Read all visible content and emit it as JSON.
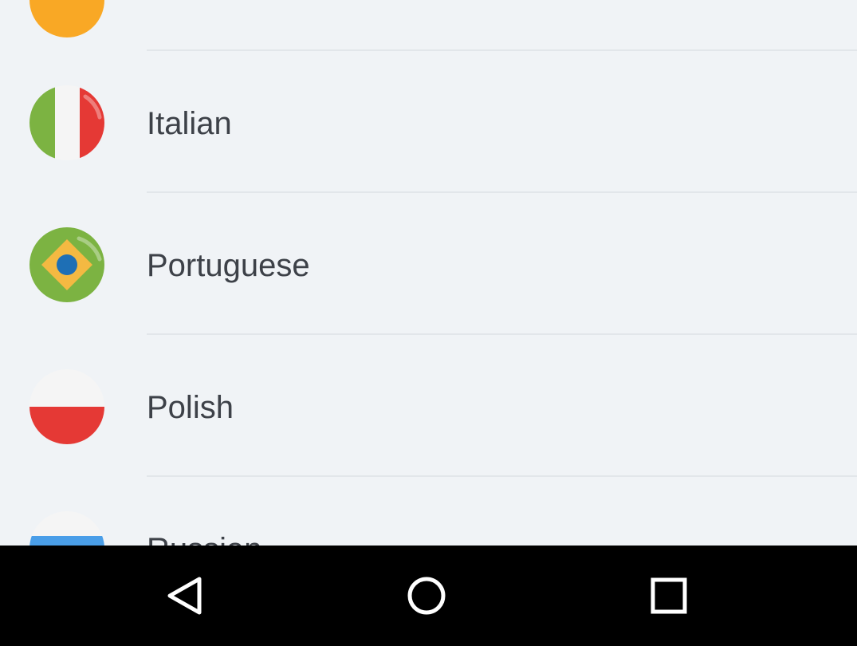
{
  "languages": [
    {
      "label": "",
      "flag_icon": "orange-flag-icon",
      "color": "#f9a825"
    },
    {
      "label": "Italian",
      "flag_icon": "italy-flag-icon",
      "colors": [
        "#7cb342",
        "#f5f5f5",
        "#e53935"
      ]
    },
    {
      "label": "Portuguese",
      "flag_icon": "brazil-flag-icon",
      "colors": [
        "#7cb342",
        "#f4b942",
        "#1e6fb5"
      ]
    },
    {
      "label": "Polish",
      "flag_icon": "poland-flag-icon",
      "colors": [
        "#f5f5f5",
        "#e53935"
      ]
    },
    {
      "label": "Russian",
      "flag_icon": "russia-flag-icon",
      "colors": [
        "#f5f5f5",
        "#4a9ee8",
        "#e53935"
      ]
    }
  ],
  "navigation_bar": {
    "back_icon": "back-triangle-icon",
    "home_icon": "home-circle-icon",
    "recents_icon": "recents-square-icon",
    "background": "#000000"
  }
}
